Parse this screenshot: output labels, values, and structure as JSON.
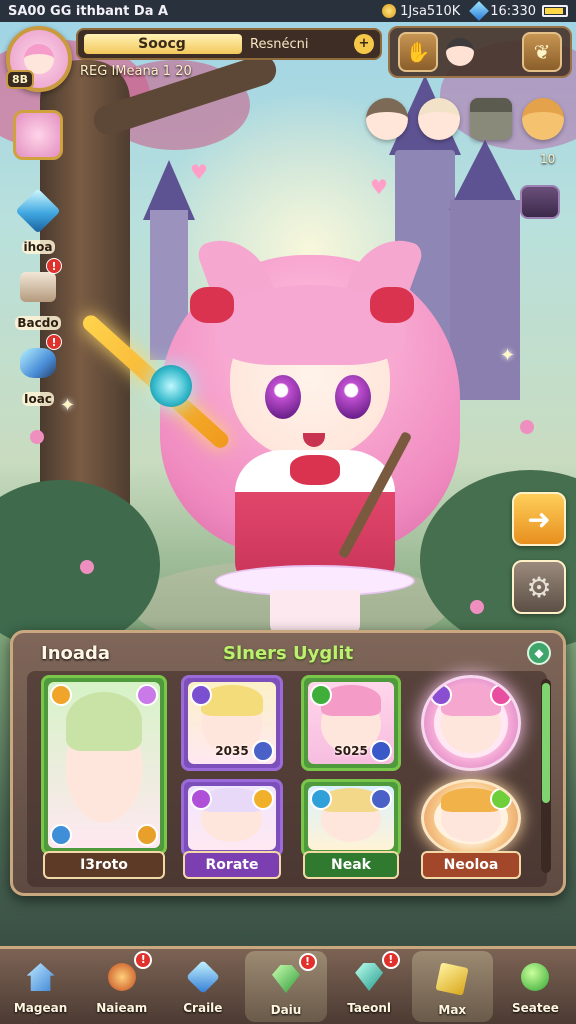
{
  "statusbar": {
    "left_text": "SA00 GG ithbant Da A",
    "coins": "1Jsa510K",
    "gems": "16:330"
  },
  "profile": {
    "level": "8B",
    "name": "Soocg",
    "rank": "Resnécni",
    "subtitle": "REG IMeana 1 20",
    "action_symbol": "+"
  },
  "friends": {
    "count": "10"
  },
  "side_buttons": [
    {
      "label": "",
      "icon": "profile-portrait-icon"
    },
    {
      "label": "ihoa",
      "icon": "crystal-icon"
    },
    {
      "label": "Bacdo",
      "icon": "hammer-icon",
      "badge": "!"
    },
    {
      "label": "Ioac",
      "icon": "ore-icon",
      "badge": "!"
    }
  ],
  "right_buttons": {
    "arrow_symbol": "➜",
    "gear_symbol": "⚙"
  },
  "panel": {
    "title": "Inoada",
    "subtitle": "Slners Uyglit",
    "toggle_symbol": "◆",
    "cards": [
      {
        "name": "I3roto",
        "value": "",
        "rarity_color": "#79c64a"
      },
      {
        "name": "",
        "value": "2035",
        "rarity_color": "#9b6bd8"
      },
      {
        "name": "",
        "value": "S025",
        "rarity_color": "#79c64a"
      },
      {
        "name": "",
        "value": "",
        "rarity_color": "#f4a8d4"
      },
      {
        "name": "Rorate",
        "value": "",
        "rarity_color": "#9b6bd8"
      },
      {
        "name": "Neak",
        "value": "",
        "rarity_color": "#79c64a"
      },
      {
        "name": "Neoloa",
        "value": "",
        "rarity_color": "#f7c98a"
      }
    ]
  },
  "nav": [
    {
      "label": "Magean",
      "icon": "house-icon",
      "badge": ""
    },
    {
      "label": "Naieam",
      "icon": "orb-icon",
      "badge": "!"
    },
    {
      "label": "Craile",
      "icon": "crystal-icon",
      "badge": ""
    },
    {
      "label": "Daiu",
      "icon": "emerald-icon",
      "badge": "!"
    },
    {
      "label": "Taeonl",
      "icon": "teal-gem-icon",
      "badge": "!"
    },
    {
      "label": "Max",
      "icon": "gold-ingot-icon",
      "badge": ""
    },
    {
      "label": "Seatee",
      "icon": "green-orb-icon",
      "badge": ""
    }
  ],
  "colors": {
    "accent_gold": "#c99a3e",
    "panel_border": "#c9a880",
    "badge_red": "#e0322d",
    "highlight_green": "#bdf06f"
  }
}
